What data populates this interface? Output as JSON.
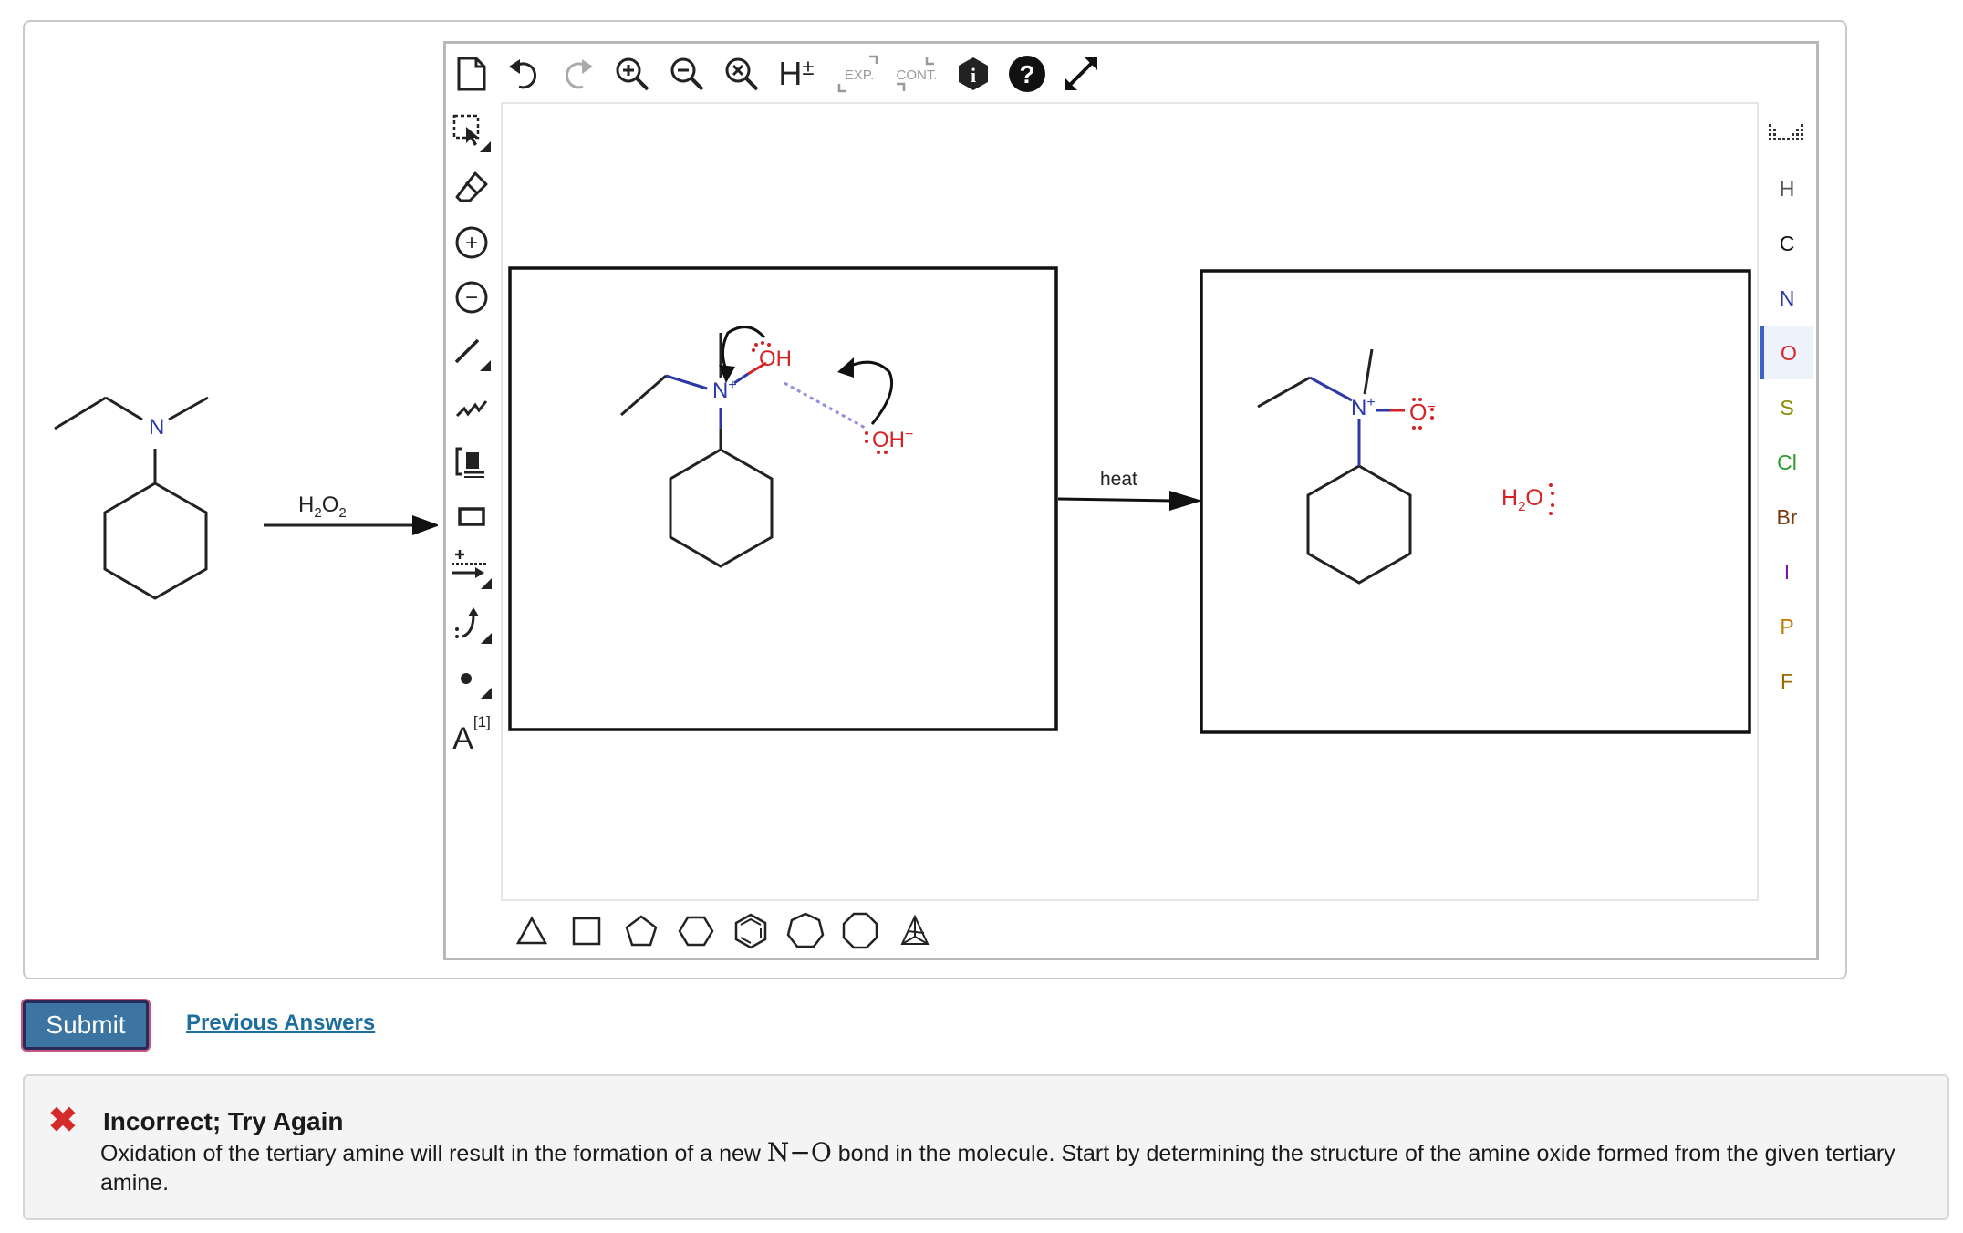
{
  "reaction": {
    "reactant_atom_N": "N",
    "reagent": {
      "main": "H",
      "sub1": "2",
      "mid": "O",
      "sub2": "2"
    }
  },
  "toolbar": {
    "hydrogen_label": "H",
    "hydrogen_sign": "±",
    "expand_label": "EXP.",
    "contract_label": "CONT.",
    "info_symbol": "i",
    "help_symbol": "?"
  },
  "left_tools": {
    "charge_plus": "+",
    "charge_minus": "−",
    "text_tool_label": "A",
    "text_tool_sup": "[1]"
  },
  "canvas": {
    "box1": {
      "nitrogen_label": "N",
      "nitrogen_charge": "+",
      "hydroxyl_label": "OH",
      "hydroxide_label": "OH",
      "hydroxide_charge": "−"
    },
    "arrow_label": "heat",
    "box2": {
      "nitrogen_label": "N",
      "nitrogen_charge": "+",
      "oxygen_label": "O",
      "oxygen_charge": "−",
      "water": {
        "main": "H",
        "sub": "2",
        "end": "O"
      }
    }
  },
  "elements": [
    "H",
    "C",
    "N",
    "O",
    "S",
    "Cl",
    "Br",
    "I",
    "P",
    "F"
  ],
  "element_colors": {
    "H": "#555555",
    "C": "#111111",
    "N": "#2b3aa8",
    "O": "#d62222",
    "S": "#8a8a00",
    "Cl": "#2f9a2f",
    "Br": "#7a3b0c",
    "I": "#7a1a9a",
    "P": "#c47a00",
    "F": "#9a6a00"
  },
  "selected_element": "O",
  "submit_label": "Submit",
  "previous_answers_label": "Previous Answers",
  "feedback": {
    "icon": "✖",
    "title": "Incorrect; Try Again",
    "message_before": "Oxidation of the tertiary amine will result in the formation of a new ",
    "message_bond": "N−O",
    "message_after": " bond in the molecule. Start by determining the structure of the amine oxide formed from the given tertiary amine."
  }
}
